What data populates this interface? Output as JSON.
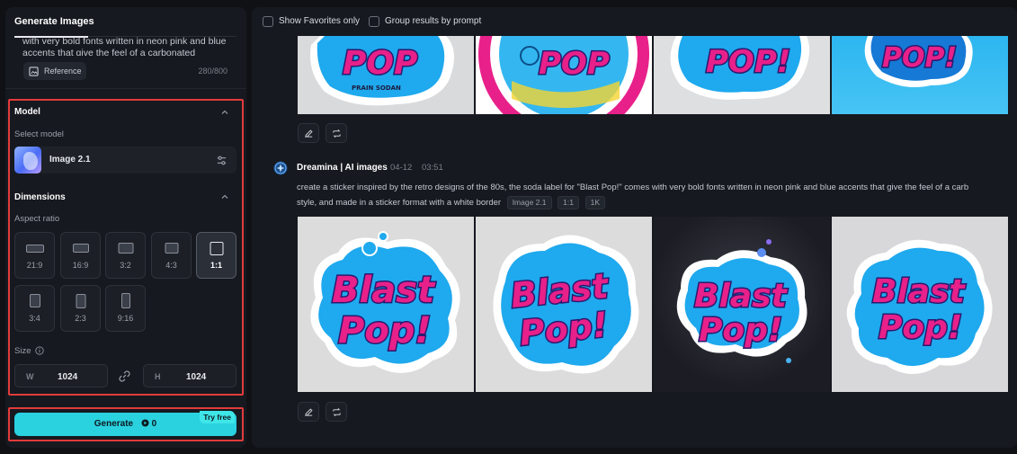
{
  "left_panel": {
    "tab_title": "Generate Images",
    "prompt_preview": "with very bold fonts written in neon pink and blue accents that give the feel of a carbonated",
    "reference_label": "Reference",
    "char_count": "280/800",
    "model_section": {
      "title": "Model",
      "select_label": "Select model",
      "model_name": "Image 2.1"
    },
    "dimensions_section": {
      "title": "Dimensions",
      "aspect_label": "Aspect ratio",
      "ratios": [
        "21:9",
        "16:9",
        "3:2",
        "4:3",
        "1:1",
        "3:4",
        "2:3",
        "9:16"
      ],
      "selected_ratio": "1:1",
      "size_label": "Size",
      "width_key": "W",
      "width_value": "1024",
      "height_key": "H",
      "height_value": "1024"
    },
    "generate": {
      "label": "Generate",
      "credits": "0",
      "badge": "Try free"
    }
  },
  "right_panel": {
    "show_favorites_label": "Show Favorites only",
    "group_results_label": "Group results by prompt",
    "first_batch": {
      "image_texts": [
        "POP",
        "POP",
        "POP!",
        "POP!"
      ],
      "brand_text": "PRAIN SODAN"
    },
    "second_batch": {
      "author": "Dreamina | AI images",
      "date": "04-12",
      "time": "03:51",
      "prompt_line1": "create a sticker inspired by the retro designs of the 80s, the soda label for \"Blast Pop!\" comes with very bold fonts written in neon pink and blue accents that give the feel of a carb",
      "prompt_line2": "style, and made in a sticker format with a white border",
      "tags": [
        "Image 2.1",
        "1:1",
        "1K"
      ],
      "image_texts": [
        [
          "Blast",
          "Pop!"
        ],
        [
          "Blast",
          "Pop!"
        ],
        [
          "Blast",
          "Pop!"
        ],
        [
          "Blast",
          "Pop!"
        ]
      ]
    }
  },
  "colors": {
    "accent": "#2ad2e0",
    "highlight_border": "#e23b3b",
    "sticker_pink": "#e8208a",
    "sticker_blue": "#1fa9ee"
  }
}
